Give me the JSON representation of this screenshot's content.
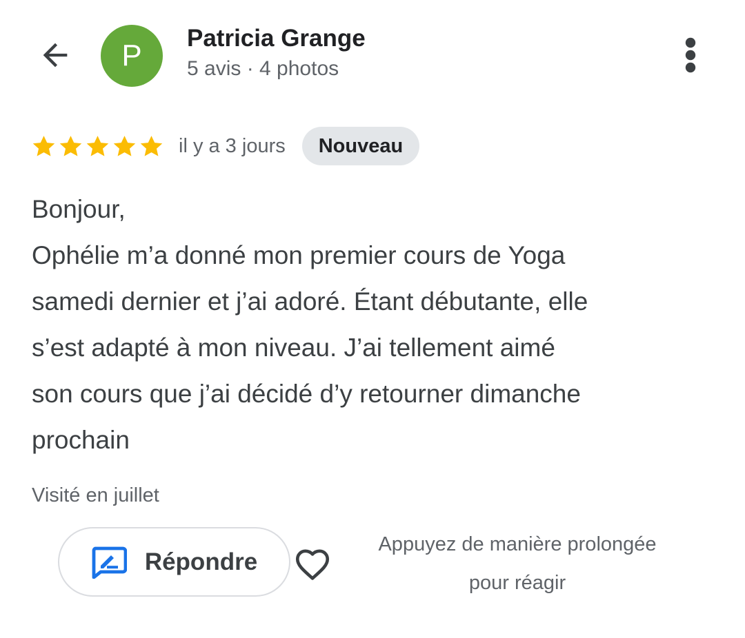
{
  "header": {
    "back_icon": "arrow-back-icon",
    "avatar_letter": "P",
    "avatar_color": "#65a93a",
    "author_name": "Patricia Grange",
    "author_meta": "5 avis · 4 photos",
    "more_icon": "more-vert-icon"
  },
  "review": {
    "rating": 5,
    "rating_max": 5,
    "star_color": "#fbbc04",
    "date": "il y a 3 jours",
    "badge": "Nouveau",
    "text_lines": [
      "Bonjour,",
      "Ophélie m’a donné mon premier cours de Yoga",
      "samedi dernier et j’ai adoré. Étant débutante, elle",
      "s’est adapté à mon niveau. J’ai tellement aimé",
      "son cours que j’ai décidé d’y retourner dimanche",
      "prochain"
    ],
    "visit": "Visité en juillet"
  },
  "actions": {
    "reply_label": "Répondre",
    "reply_icon": "rate-review-icon",
    "reply_icon_color": "#1a73e8",
    "heart_icon": "heart-outline-icon",
    "react_hint_lines": [
      "Appuyez de manière prolongée",
      "pour réagir"
    ]
  }
}
